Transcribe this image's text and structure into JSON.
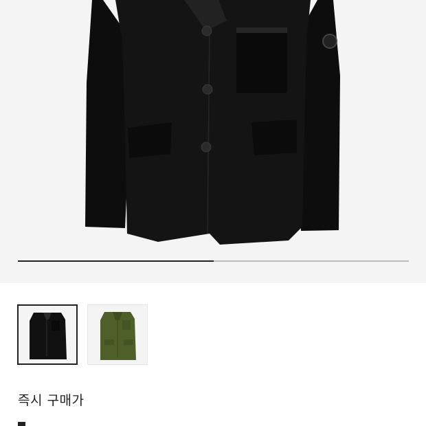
{
  "product": {
    "image_icon": "black-jacket-photo",
    "gallery_progress": 0.5
  },
  "thumbnails": [
    {
      "icon": "black-jacket-thumbnail",
      "color": "#111111",
      "selected": true
    },
    {
      "icon": "olive-jacket-thumbnail",
      "color": "#4f5f2a",
      "selected": false
    }
  ],
  "purchase": {
    "instant_price_label": "즉시 구매가"
  },
  "colors": {
    "hero_bg": "#f4f4f4",
    "text": "#222222",
    "progress_active": "#222222",
    "progress_track": "#bdbdbd"
  }
}
